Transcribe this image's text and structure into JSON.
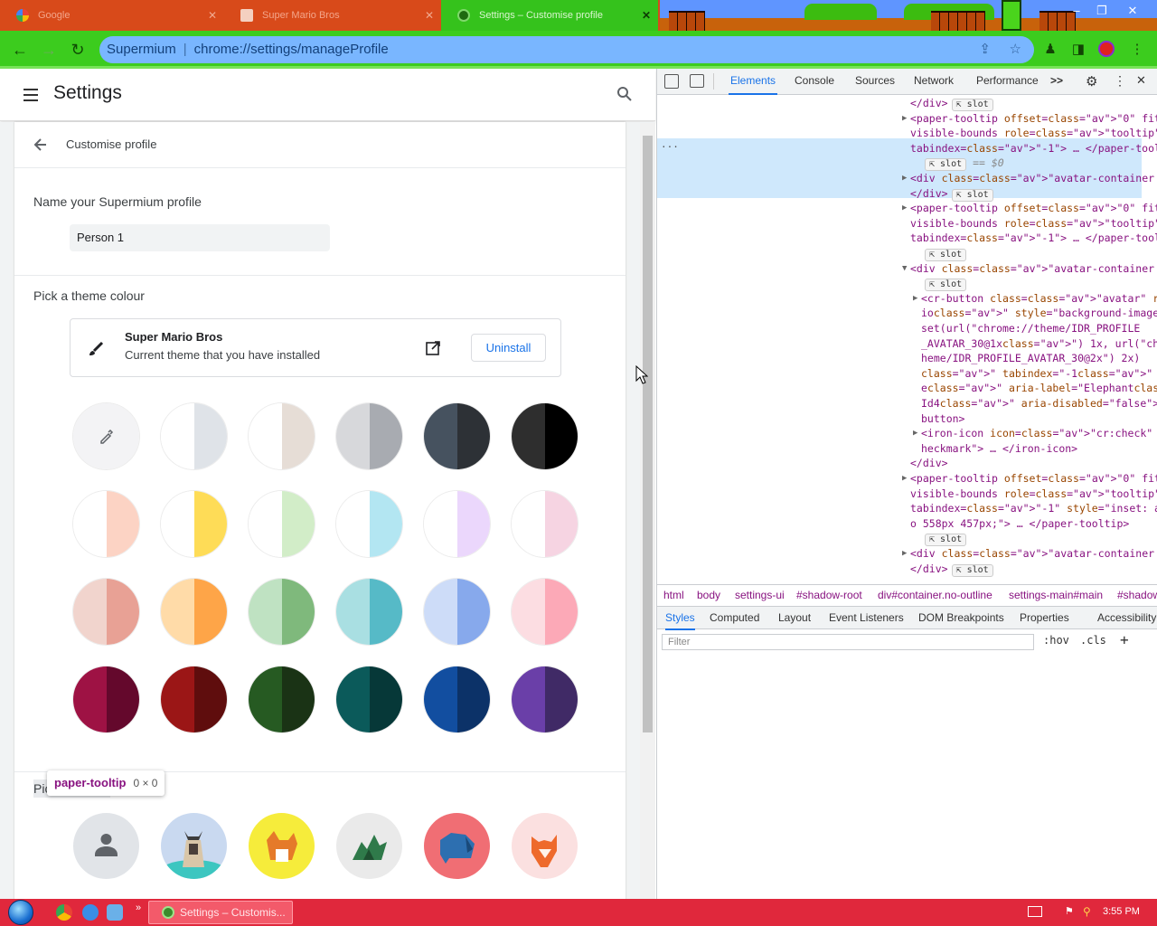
{
  "browser": {
    "tabs": [
      {
        "title": "Google",
        "active": false
      },
      {
        "title": "Super Mario Bros",
        "active": false
      },
      {
        "title": "Settings – Customise profile",
        "active": true
      }
    ],
    "address": {
      "site": "Supermium",
      "url": "chrome://settings/manageProfile"
    }
  },
  "settings": {
    "title": "Settings",
    "subpage_title": "Customise profile",
    "name_label": "Name your Supermium profile",
    "name_value": "Person 1",
    "theme_label": "Pick a theme colour",
    "theme_name": "Super Mario Bros",
    "theme_desc": "Current theme that you have installed",
    "uninstall_label": "Uninstall",
    "avatar_label_partial": "Pic",
    "swatches": [
      [
        "#f3f3f5",
        "#f3f3f5"
      ],
      [
        "#ffffff",
        "#dfe3e8"
      ],
      [
        "#ffffff",
        "#e6ddd6"
      ],
      [
        "#d7d8db",
        "#a8abb1"
      ],
      [
        "#46525f",
        "#2d3136"
      ],
      [
        "#2e2e2e",
        "#000000"
      ],
      [
        "#ffffff",
        "#fcd3c4"
      ],
      [
        "#ffffff",
        "#fedc57"
      ],
      [
        "#ffffff",
        "#d2edc8"
      ],
      [
        "#ffffff",
        "#b3e6f2"
      ],
      [
        "#ffffff",
        "#ebd7fc"
      ],
      [
        "#ffffff",
        "#f6d4e2"
      ],
      [
        "#f1d4cd",
        "#e8a195"
      ],
      [
        "#ffdba8",
        "#fea548"
      ],
      [
        "#bfe2c2",
        "#7fb97c"
      ],
      [
        "#a9dfe2",
        "#56bac7"
      ],
      [
        "#cddcf8",
        "#87a9ec"
      ],
      [
        "#fcdde2",
        "#fca9b7"
      ],
      [
        "#9e1244",
        "#64082c"
      ],
      [
        "#9b1616",
        "#5f0d0d"
      ],
      [
        "#265a22",
        "#1a3315"
      ],
      [
        "#0b5a5a",
        "#063838"
      ],
      [
        "#124ea0",
        "#0c3268"
      ],
      [
        "#6a3fa8",
        "#402a66"
      ]
    ],
    "avatars": [
      "person",
      "cat",
      "corgi",
      "dragon",
      "elephant",
      "fox"
    ]
  },
  "tooltip": {
    "tag": "paper-tooltip",
    "dims": "0 × 0"
  },
  "devtools": {
    "tabs": [
      "Elements",
      "Console",
      "Sources",
      "Network",
      "Performance"
    ],
    "more": ">>",
    "ellipsis": "...",
    "dom_lines": [
      {
        "indent": 0,
        "arrow": "",
        "text": "</div>",
        "slot": true
      },
      {
        "indent": 0,
        "arrow": "▶",
        "text": "<paper-tooltip offset=\"0\" fit-to-",
        "slot": false
      },
      {
        "indent": 0,
        "arrow": "",
        "text": "visible-bounds role=\"tooltip\"",
        "slot": false
      },
      {
        "indent": 0,
        "arrow": "",
        "text": "tabindex=\"-1\"> … </paper-tooltip>",
        "slot": false
      },
      {
        "indent": 1,
        "arrow": "",
        "text": "== $0",
        "slot": true
      },
      {
        "indent": 0,
        "arrow": "▶",
        "text": "<div class=\"avatar-container \"> …",
        "slot": false
      },
      {
        "indent": 0,
        "arrow": "",
        "text": "</div>",
        "slot": true
      },
      {
        "indent": 0,
        "arrow": "▶",
        "text": "<paper-tooltip offset=\"0\" fit-to-",
        "slot": false
      },
      {
        "indent": 0,
        "arrow": "",
        "text": "visible-bounds role=\"tooltip\"",
        "slot": false
      },
      {
        "indent": 0,
        "arrow": "",
        "text": "tabindex=\"-1\"> … </paper-tooltip>",
        "slot": false
      },
      {
        "indent": 1,
        "arrow": "",
        "text": "",
        "slot": true
      },
      {
        "indent": 0,
        "arrow": "▼",
        "text": "<div class=\"avatar-container \">",
        "slot": false
      },
      {
        "indent": 1,
        "arrow": "",
        "text": "",
        "slot": true
      },
      {
        "indent": 1,
        "arrow": "▶",
        "text": "<cr-button class=\"avatar\" role=\"rad",
        "slot": false
      },
      {
        "indent": 1,
        "arrow": "",
        "text": "io\" style=\"background-image: image-",
        "slot": false
      },
      {
        "indent": 1,
        "arrow": "",
        "text": "set(url(\"chrome://theme/IDR_PROFILE",
        "slot": false
      },
      {
        "indent": 1,
        "arrow": "",
        "text": "_AVATAR_30@1x\") 1x, url(\"chrome://t",
        "slot": false
      },
      {
        "indent": 1,
        "arrow": "",
        "text": "heme/IDR_PROFILE_AVATAR_30@2x\") 2x)",
        "slot": false
      },
      {
        "indent": 1,
        "arrow": "",
        "text": "\" tabindex=\"-1\" aria-checked=\"fals",
        "slot": false
      },
      {
        "indent": 1,
        "arrow": "",
        "text": "e\" aria-label=\"Elephant\" id=\"avatar",
        "slot": false
      },
      {
        "indent": 1,
        "arrow": "",
        "text": "Id4\" aria-disabled=\"false\"> … </cr-",
        "slot": false
      },
      {
        "indent": 1,
        "arrow": "",
        "text": "button>",
        "slot": false
      },
      {
        "indent": 1,
        "arrow": "▶",
        "text": "<iron-icon icon=\"cr:check\" class=\"c",
        "slot": false
      },
      {
        "indent": 1,
        "arrow": "",
        "text": "heckmark\"> … </iron-icon>",
        "slot": false
      },
      {
        "indent": 0,
        "arrow": "",
        "text": "</div>",
        "slot": false
      },
      {
        "indent": 0,
        "arrow": "▶",
        "text": "<paper-tooltip offset=\"0\" fit-to-",
        "slot": false
      },
      {
        "indent": 0,
        "arrow": "",
        "text": "visible-bounds role=\"tooltip\"",
        "slot": false
      },
      {
        "indent": 0,
        "arrow": "",
        "text": "tabindex=\"-1\" style=\"inset: auto aut",
        "slot": false
      },
      {
        "indent": 0,
        "arrow": "",
        "text": "o 558px 457px;\"> … </paper-tooltip>",
        "slot": false
      },
      {
        "indent": 1,
        "arrow": "",
        "text": "",
        "slot": true
      },
      {
        "indent": 0,
        "arrow": "▶",
        "text": "<div class=\"avatar-container \"> …",
        "slot": false
      },
      {
        "indent": 0,
        "arrow": "",
        "text": "</div>",
        "slot": true
      }
    ],
    "slot_label": "slot",
    "breadcrumbs": [
      "html",
      "body",
      "settings-ui",
      "#shadow-root",
      "div#container.no-outline",
      "settings-main#main",
      "#shadow"
    ],
    "panel_tabs": [
      "Styles",
      "Computed",
      "Layout",
      "Event Listeners",
      "DOM Breakpoints",
      "Properties",
      "Accessibility"
    ],
    "filter_placeholder": "Filter",
    "hov": ":hov",
    "cls": ".cls"
  },
  "taskbar": {
    "item_title": "Settings – Customis...",
    "clock": "3:55 PM"
  }
}
